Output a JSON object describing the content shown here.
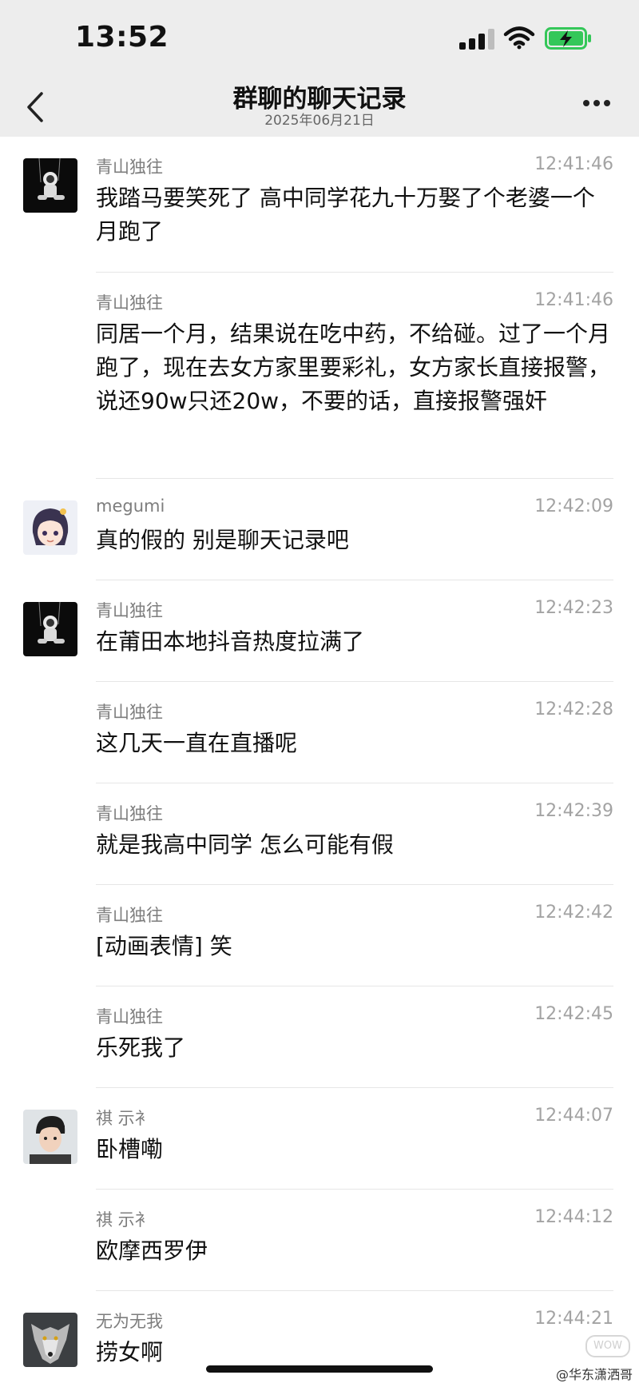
{
  "status_bar": {
    "time": "13:52"
  },
  "nav": {
    "title": "群聊的聊天记录",
    "subtitle": "2025年06月21日"
  },
  "messages": [
    {
      "sender": "青山独往",
      "time": "12:41:46",
      "text": "我踏马要笑死了 高中同学花九十万娶了个老婆一个月跑了",
      "avatar": "astronaut-avatar"
    },
    {
      "sender": "青山独往",
      "time": "12:41:46",
      "text": "同居一个月，结果说在吃中药，不给碰。过了一个月跑了，现在去女方家里要彩礼，女方家长直接报警，说还90w只还20w，不要的话，直接报警强奸"
    },
    {
      "sender": "megumi",
      "time": "12:42:09",
      "text": "真的假的  别是聊天记录吧",
      "avatar": "anime-girl-avatar"
    },
    {
      "sender": "青山独往",
      "time": "12:42:23",
      "text": "在莆田本地抖音热度拉满了",
      "avatar": "astronaut-avatar"
    },
    {
      "sender": "青山独往",
      "time": "12:42:28",
      "text": "这几天一直在直播呢"
    },
    {
      "sender": "青山独往",
      "time": "12:42:39",
      "text": "就是我高中同学 怎么可能有假"
    },
    {
      "sender": "青山独往",
      "time": "12:42:42",
      "text": "[动画表情] 笑"
    },
    {
      "sender": "青山独往",
      "time": "12:42:45",
      "text": "乐死我了"
    },
    {
      "sender": "祺 示衤",
      "time": "12:44:07",
      "text": "卧槽嘞",
      "avatar": "man-portrait-avatar"
    },
    {
      "sender": "祺 示衤",
      "time": "12:44:12",
      "text": "欧摩西罗伊"
    },
    {
      "sender": "无为无我",
      "time": "12:44:21",
      "text": "捞女啊",
      "avatar": "wolf-avatar"
    }
  ],
  "watermark": {
    "logo": "WOW",
    "text": "@华东潇洒哥"
  },
  "colors": {
    "header_bg": "#ededed",
    "battery_green": "#34c759"
  }
}
